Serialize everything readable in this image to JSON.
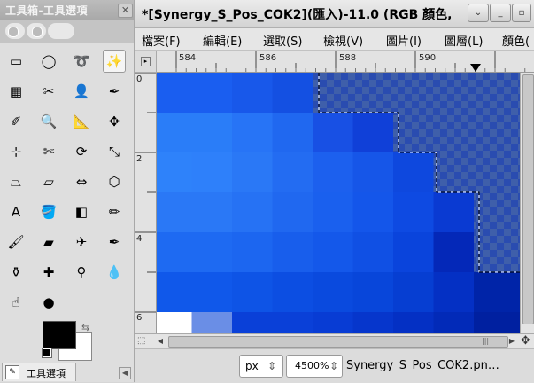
{
  "toolbox": {
    "title": "工具箱-工具選項",
    "close_glyph": "✕",
    "tools": [
      {
        "name": "rect-select-icon",
        "glyph": "▭"
      },
      {
        "name": "ellipse-select-icon",
        "glyph": "◯"
      },
      {
        "name": "free-select-icon",
        "glyph": "➰"
      },
      {
        "name": "fuzzy-select-icon",
        "glyph": "✨",
        "active": true
      },
      {
        "name": "select-by-color-icon",
        "glyph": "▦"
      },
      {
        "name": "scissors-select-icon",
        "glyph": "✂"
      },
      {
        "name": "foreground-select-icon",
        "glyph": "👤"
      },
      {
        "name": "paths-icon",
        "glyph": "✒"
      },
      {
        "name": "color-picker-icon",
        "glyph": "✐"
      },
      {
        "name": "zoom-icon",
        "glyph": "🔍"
      },
      {
        "name": "measure-icon",
        "glyph": "📐"
      },
      {
        "name": "move-icon",
        "glyph": "✥"
      },
      {
        "name": "align-icon",
        "glyph": "⊹"
      },
      {
        "name": "crop-icon",
        "glyph": "✄"
      },
      {
        "name": "rotate-icon",
        "glyph": "⟳"
      },
      {
        "name": "scale-icon",
        "glyph": "⤡"
      },
      {
        "name": "shear-icon",
        "glyph": "⏢"
      },
      {
        "name": "perspective-icon",
        "glyph": "⏥"
      },
      {
        "name": "flip-icon",
        "glyph": "⇔"
      },
      {
        "name": "cage-transform-icon",
        "glyph": "⬡"
      },
      {
        "name": "text-icon",
        "glyph": "A"
      },
      {
        "name": "bucket-fill-icon",
        "glyph": "🪣"
      },
      {
        "name": "blend-icon",
        "glyph": "◧"
      },
      {
        "name": "pencil-icon",
        "glyph": "✏"
      },
      {
        "name": "paintbrush-icon",
        "glyph": "🖌"
      },
      {
        "name": "eraser-icon",
        "glyph": "▰"
      },
      {
        "name": "airbrush-icon",
        "glyph": "✈"
      },
      {
        "name": "ink-icon",
        "glyph": "✒"
      },
      {
        "name": "clone-icon",
        "glyph": "⚱"
      },
      {
        "name": "heal-icon",
        "glyph": "✚"
      },
      {
        "name": "perspective-clone-icon",
        "glyph": "⚲"
      },
      {
        "name": "blur-sharpen-icon",
        "glyph": "💧"
      },
      {
        "name": "smudge-icon",
        "glyph": "☝"
      },
      {
        "name": "dodge-burn-icon",
        "glyph": "●"
      }
    ],
    "swap_glyph": "⇆",
    "colors": {
      "foreground": "#000000",
      "background": "#ffffff"
    },
    "tab_label": "工具選項",
    "tab_icon_glyph": "✎",
    "tab_arrow_glyph": "◀"
  },
  "image_window": {
    "title": "*[Synergy_S_Pos_COK2](匯入)-11.0 (RGB 顏色,",
    "buttons": {
      "menu": "⌄",
      "minimize": "_",
      "maximize": "▫",
      "close": "✕"
    },
    "menus": [
      "檔案(F)",
      "編輯(E)",
      "選取(S)",
      "檢視(V)",
      "圖片(I)",
      "圖層(L)",
      "顏色("
    ],
    "ruler_corner_glyph": "▸",
    "hruler_labels": [
      "584",
      "586",
      "588",
      "590"
    ],
    "vruler_labels": [
      "0",
      "2",
      "4",
      "6"
    ],
    "status": {
      "unit": "px",
      "zoom": "4500%",
      "filename": "Synergy_S_Pos_COK2.pn…",
      "spin_glyph": "⇕",
      "nav_glyph": "✥",
      "quickmask_glyph": "⬚"
    }
  }
}
